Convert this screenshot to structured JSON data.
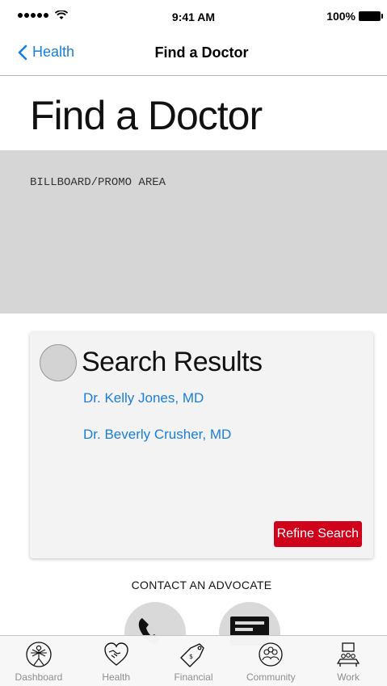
{
  "status_bar": {
    "time": "9:41 AM",
    "battery": "100%"
  },
  "nav": {
    "back_label": "Health",
    "title": "Find a Doctor"
  },
  "page": {
    "title": "Find a Doctor"
  },
  "billboard": {
    "label": "BILLBOARD/PROMO AREA"
  },
  "results": {
    "title": "Search Results",
    "doctors": [
      "Dr. Kelly Jones, MD",
      "Dr. Beverly Crusher, MD"
    ],
    "refine_label": "Refine Search"
  },
  "contact": {
    "heading": "CONTACT AN ADVOCATE",
    "buttons": [
      {
        "icon": "phone-icon"
      },
      {
        "icon": "message-icon"
      }
    ]
  },
  "tab_bar": {
    "items": [
      {
        "label": "Dashboard",
        "icon": "vitruvian-man-icon"
      },
      {
        "label": "Health",
        "icon": "handshake-heart-icon"
      },
      {
        "label": "Financial",
        "icon": "price-tag-icon"
      },
      {
        "label": "Community",
        "icon": "people-circle-icon"
      },
      {
        "label": "Work",
        "icon": "meeting-table-icon"
      }
    ]
  },
  "colors": {
    "link": "#1a7ed9",
    "refine_button": "#d0021b",
    "billboard_bg": "#d6d6d6",
    "card_bg": "#f3f3f3"
  }
}
